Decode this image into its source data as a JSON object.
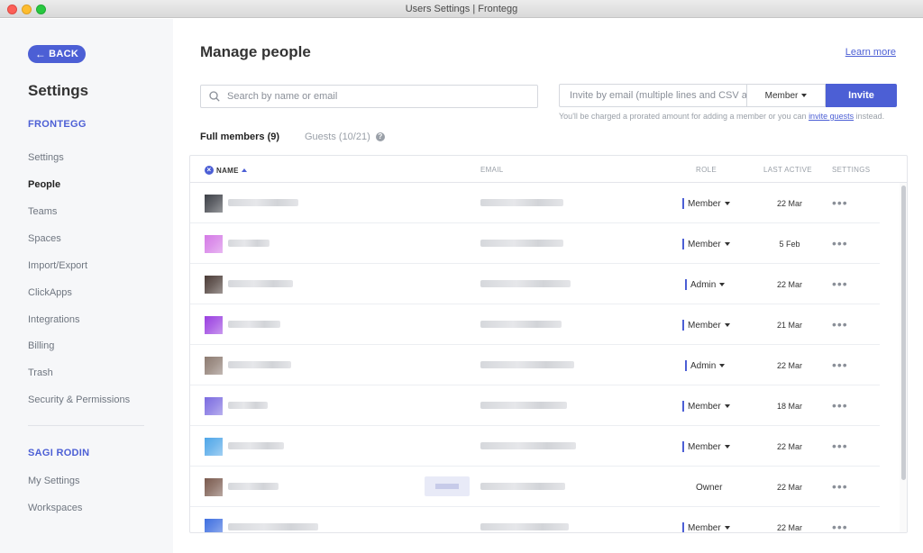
{
  "window": {
    "title": "Users Settings | Frontegg"
  },
  "sidebar": {
    "back_label": "BACK",
    "title": "Settings",
    "workspace_section": "FRONTEGG",
    "workspace_items": [
      {
        "label": "Settings"
      },
      {
        "label": "People",
        "active": true
      },
      {
        "label": "Teams"
      },
      {
        "label": "Spaces"
      },
      {
        "label": "Import/Export"
      },
      {
        "label": "ClickApps"
      },
      {
        "label": "Integrations"
      },
      {
        "label": "Billing"
      },
      {
        "label": "Trash"
      },
      {
        "label": "Security & Permissions"
      }
    ],
    "user_section": "SAGI RODIN",
    "user_items": [
      {
        "label": "My Settings"
      },
      {
        "label": "Workspaces"
      }
    ]
  },
  "main": {
    "title": "Manage people",
    "learn_more": "Learn more",
    "search_placeholder": "Search by name or email",
    "invite_placeholder": "Invite by email (multiple lines and CSV accepted)",
    "invite_role": "Member",
    "invite_button": "Invite",
    "charge_note_prefix": "You'll be charged a prorated amount for adding a member or you can ",
    "charge_note_link": "invite guests",
    "charge_note_suffix": " instead.",
    "tabs": {
      "full": "Full members (9)",
      "guests": "Guests (10/21)"
    },
    "columns": {
      "name": "NAME",
      "email": "EMAIL",
      "role": "ROLE",
      "last_active": "LAST ACTIVE",
      "settings": "SETTINGS"
    },
    "rows": [
      {
        "role": "Member",
        "last_active": "22 Mar",
        "avatar_color": "#3d4047"
      },
      {
        "role": "Member",
        "last_active": "5 Feb",
        "avatar_color": "#d47ae6"
      },
      {
        "role": "Admin",
        "last_active": "22 Mar",
        "avatar_color": "#4a3b36"
      },
      {
        "role": "Member",
        "last_active": "21 Mar",
        "avatar_color": "#9a3fe0"
      },
      {
        "role": "Admin",
        "last_active": "22 Mar",
        "avatar_color": "#8c7a70"
      },
      {
        "role": "Member",
        "last_active": "18 Mar",
        "avatar_color": "#7b6be0"
      },
      {
        "role": "Member",
        "last_active": "22 Mar",
        "avatar_color": "#4fa6e8"
      },
      {
        "role": "Owner",
        "last_active": "22 Mar",
        "avatar_color": "#7a5a4e"
      },
      {
        "role": "Member",
        "last_active": "22 Mar",
        "avatar_color": "#3f6fe0"
      }
    ],
    "row_settings_glyph": "•••"
  },
  "colors": {
    "accent": "#4c5fd5",
    "sidebar_bg": "#f6f7f9"
  }
}
